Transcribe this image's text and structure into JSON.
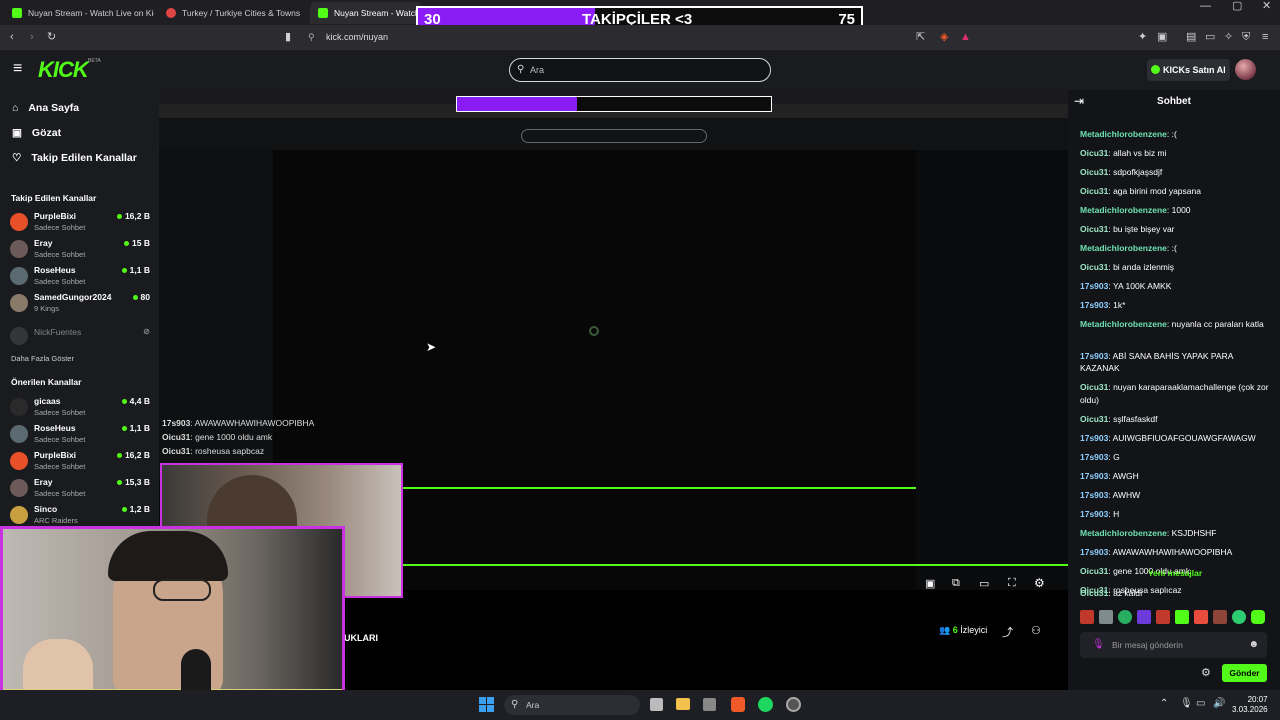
{
  "browser": {
    "tabs": [
      {
        "title": "Nuyan Stream - Watch Live on Kick",
        "active": false
      },
      {
        "title": "Turkey / Turkiye Cities & Towns",
        "active": false
      },
      {
        "title": "Nuyan Stream - Watch Li",
        "active": true
      }
    ],
    "url": "kick.com/nuyan"
  },
  "follow_goal": {
    "current": "30",
    "label": "TAKİPÇİLER <3",
    "target": "75",
    "progress": 0.4
  },
  "header": {
    "logo": "KICK",
    "logo_beta": "BETA",
    "search_placeholder": "Ara",
    "buy_kicks": "KICKs Satın Al"
  },
  "sidebar": {
    "nav": [
      {
        "label": "Ana Sayfa",
        "icon": "home-icon"
      },
      {
        "label": "Gözat",
        "icon": "browse-icon"
      },
      {
        "label": "Takip Edilen Kanallar",
        "icon": "heart-icon"
      }
    ],
    "followed_title": "Takip Edilen Kanallar",
    "followed": [
      {
        "name": "PurpleBixi",
        "sub": "Sadece Sohbet",
        "count": "16,2 B"
      },
      {
        "name": "Eray",
        "sub": "Sadece Sohbet",
        "count": "15 B"
      },
      {
        "name": "RoseHeus",
        "sub": "Sadece Sohbet",
        "count": "1,1 B"
      },
      {
        "name": "SamedGungor2024",
        "sub": "9 Kings",
        "count": "80"
      },
      {
        "name": "NickFuentes",
        "sub": "",
        "count": ""
      }
    ],
    "show_more": "Daha Fazla Göster",
    "recommended_title": "Önerilen Kanallar",
    "recommended": [
      {
        "name": "gicaas",
        "sub": "Sadece Sohbet",
        "count": "4,4 B"
      },
      {
        "name": "RoseHeus",
        "sub": "Sadece Sohbet",
        "count": "1,1 B"
      },
      {
        "name": "PurpleBixi",
        "sub": "Sadece Sohbet",
        "count": "16,2 B"
      },
      {
        "name": "Eray",
        "sub": "Sadece Sohbet",
        "count": "15,3 B"
      },
      {
        "name": "Sinco",
        "sub": "ARC Raiders",
        "count": "1,2 B"
      }
    ]
  },
  "stream": {
    "viewers": "6",
    "viewers_label": "İzleyici",
    "title_fragment": "UKLARI"
  },
  "overlay_chat": [
    {
      "user": "17s903",
      "text": "AWAWAWHAWIHAWOOPIBHA"
    },
    {
      "user": "Oicu31",
      "text": "gene 1000 oldu amk"
    },
    {
      "user": "Oicu31",
      "text": "rosheusa sapbcaz"
    }
  ],
  "chat": {
    "title": "Sohbet",
    "messages": [
      {
        "user": "Metadichlorobenzene",
        "text": ":(",
        "color": "#6fe3b3"
      },
      {
        "user": "Oicu31",
        "text": "allah vs biz mi",
        "color": "#9be7c5"
      },
      {
        "user": "Oicu31",
        "text": "sdpofkjaşsdjf",
        "color": "#9be7c5"
      },
      {
        "user": "Oicu31",
        "text": "aga birini mod yapsana",
        "color": "#9be7c5"
      },
      {
        "user": "Metadichlorobenzene",
        "text": "1000",
        "color": "#6fe3b3"
      },
      {
        "user": "Oicu31",
        "text": "bu işte bişey var",
        "color": "#9be7c5"
      },
      {
        "user": "Metadichlorobenzene",
        "text": ":(",
        "color": "#6fe3b3"
      },
      {
        "user": "Oicu31",
        "text": "bi anda izlenmiş",
        "color": "#9be7c5"
      },
      {
        "user": "17s903",
        "text": "YA 100K AMKK",
        "color": "#8fd0ff"
      },
      {
        "user": "17s903",
        "text": "1k*",
        "color": "#8fd0ff"
      },
      {
        "user": "Metadichlorobenzene",
        "text": "nuyanla cc paraları katla",
        "color": "#6fe3b3"
      },
      {
        "user": "17s903",
        "text": "ABİ SANA BAHİS YAPAK PARA KAZANAK",
        "color": "#8fd0ff"
      },
      {
        "user": "Oicu31",
        "text": "nuyan karaparaaklamachallenge (çok zor oldu)",
        "color": "#9be7c5"
      },
      {
        "user": "Oicu31",
        "text": "sşlfasfaskdf",
        "color": "#9be7c5"
      },
      {
        "user": "17s903",
        "text": "AUIWGBFIUOAFGOUAWGFAWAGW",
        "color": "#8fd0ff"
      },
      {
        "user": "17s903",
        "text": "G",
        "color": "#8fd0ff"
      },
      {
        "user": "17s903",
        "text": "AWGH",
        "color": "#8fd0ff"
      },
      {
        "user": "17s903",
        "text": "AWHW",
        "color": "#8fd0ff"
      },
      {
        "user": "17s903",
        "text": "H",
        "color": "#8fd0ff"
      },
      {
        "user": "Metadichlorobenzene",
        "text": "KSJDHSHF",
        "color": "#6fe3b3"
      },
      {
        "user": "17s903",
        "text": "AWAWAWHAWIHAWOOPIBHA",
        "color": "#8fd0ff"
      },
      {
        "user": "Oicu31",
        "text": "gene 1000 oldu amk",
        "color": "#9be7c5"
      },
      {
        "user": "Oicu31",
        "text": "rosheusa saplıcaz",
        "color": "#9be7c5"
      }
    ],
    "new_messages": "Yeni mesajlar",
    "after_new": {
      "user": "Oicu31",
      "text": "az kaldı",
      "color": "#9be7c5"
    },
    "input_placeholder": "Bir mesaj gönderin",
    "send_label": "Gönder"
  },
  "taskbar": {
    "search": "Ara",
    "time": "20:07",
    "date": "3.03.2026"
  }
}
